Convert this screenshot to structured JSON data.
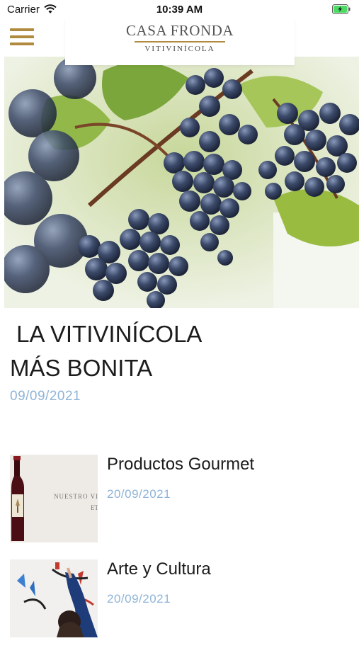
{
  "status_bar": {
    "carrier": "Carrier",
    "time": "10:39 AM"
  },
  "header": {
    "brand": "CASA FRONDA",
    "subtitle": "VITIVINÍCOLA",
    "accent_color": "#b08a3e"
  },
  "hero": {
    "title_line1": " LA VITIVINÍCOLA",
    "title_line2": "MÁS BONITA",
    "date": "09/09/2021",
    "image": "grapes-vine-image"
  },
  "articles": [
    {
      "title": "Productos Gourmet",
      "date": "20/09/2021",
      "thumb_text": "NUESTRO VI",
      "thumb_text2": "ET",
      "image": "wine-bottle-image"
    },
    {
      "title": "Arte y Cultura",
      "date": "20/09/2021",
      "image": "artist-painting-image"
    }
  ],
  "colors": {
    "date": "#8fb4d8",
    "title": "#1c1c1c"
  }
}
